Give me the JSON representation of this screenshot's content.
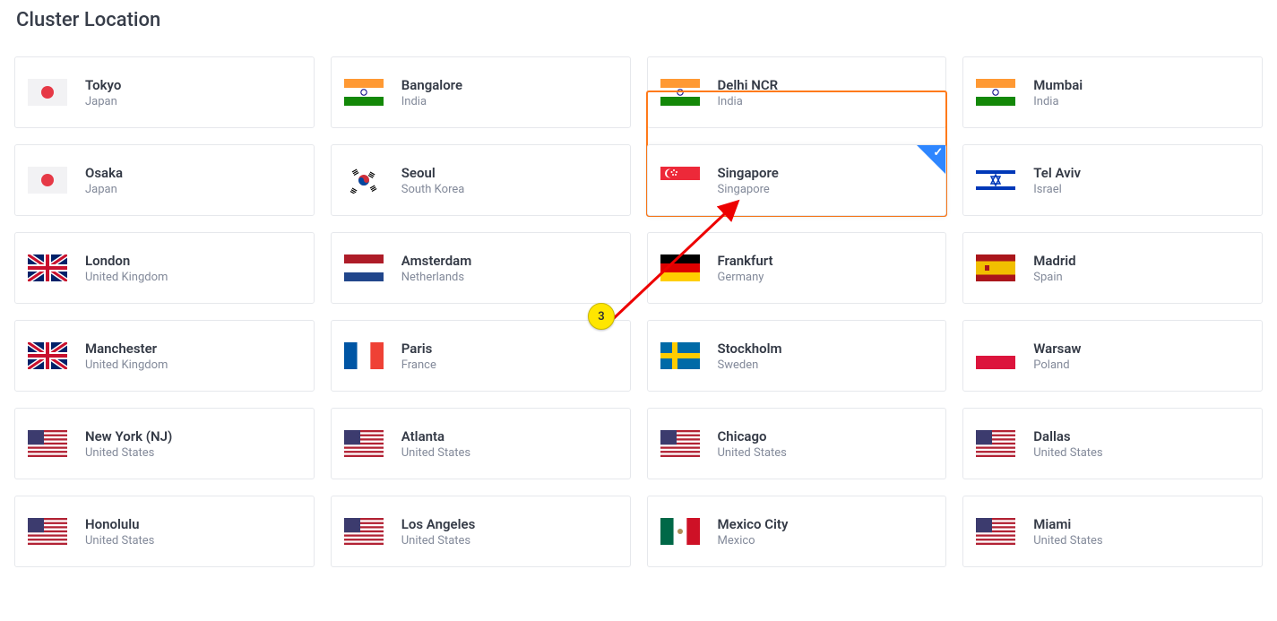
{
  "title": "Cluster Location",
  "annotation": {
    "label": "3"
  },
  "locations": [
    {
      "flag": "jp",
      "city": "Tokyo",
      "country": "Japan",
      "selected": false
    },
    {
      "flag": "in",
      "city": "Bangalore",
      "country": "India",
      "selected": false
    },
    {
      "flag": "in",
      "city": "Delhi NCR",
      "country": "India",
      "selected": false
    },
    {
      "flag": "in",
      "city": "Mumbai",
      "country": "India",
      "selected": false
    },
    {
      "flag": "jp",
      "city": "Osaka",
      "country": "Japan",
      "selected": false
    },
    {
      "flag": "kr",
      "city": "Seoul",
      "country": "South Korea",
      "selected": false
    },
    {
      "flag": "sg",
      "city": "Singapore",
      "country": "Singapore",
      "selected": true
    },
    {
      "flag": "il",
      "city": "Tel Aviv",
      "country": "Israel",
      "selected": false
    },
    {
      "flag": "gb",
      "city": "London",
      "country": "United Kingdom",
      "selected": false
    },
    {
      "flag": "nl",
      "city": "Amsterdam",
      "country": "Netherlands",
      "selected": false
    },
    {
      "flag": "de",
      "city": "Frankfurt",
      "country": "Germany",
      "selected": false
    },
    {
      "flag": "es",
      "city": "Madrid",
      "country": "Spain",
      "selected": false
    },
    {
      "flag": "gb",
      "city": "Manchester",
      "country": "United Kingdom",
      "selected": false
    },
    {
      "flag": "fr",
      "city": "Paris",
      "country": "France",
      "selected": false
    },
    {
      "flag": "se",
      "city": "Stockholm",
      "country": "Sweden",
      "selected": false
    },
    {
      "flag": "pl",
      "city": "Warsaw",
      "country": "Poland",
      "selected": false
    },
    {
      "flag": "us",
      "city": "New York (NJ)",
      "country": "United States",
      "selected": false
    },
    {
      "flag": "us",
      "city": "Atlanta",
      "country": "United States",
      "selected": false
    },
    {
      "flag": "us",
      "city": "Chicago",
      "country": "United States",
      "selected": false
    },
    {
      "flag": "us",
      "city": "Dallas",
      "country": "United States",
      "selected": false
    },
    {
      "flag": "us",
      "city": "Honolulu",
      "country": "United States",
      "selected": false
    },
    {
      "flag": "us",
      "city": "Los Angeles",
      "country": "United States",
      "selected": false
    },
    {
      "flag": "mx",
      "city": "Mexico City",
      "country": "Mexico",
      "selected": false
    },
    {
      "flag": "us",
      "city": "Miami",
      "country": "United States",
      "selected": false
    }
  ]
}
